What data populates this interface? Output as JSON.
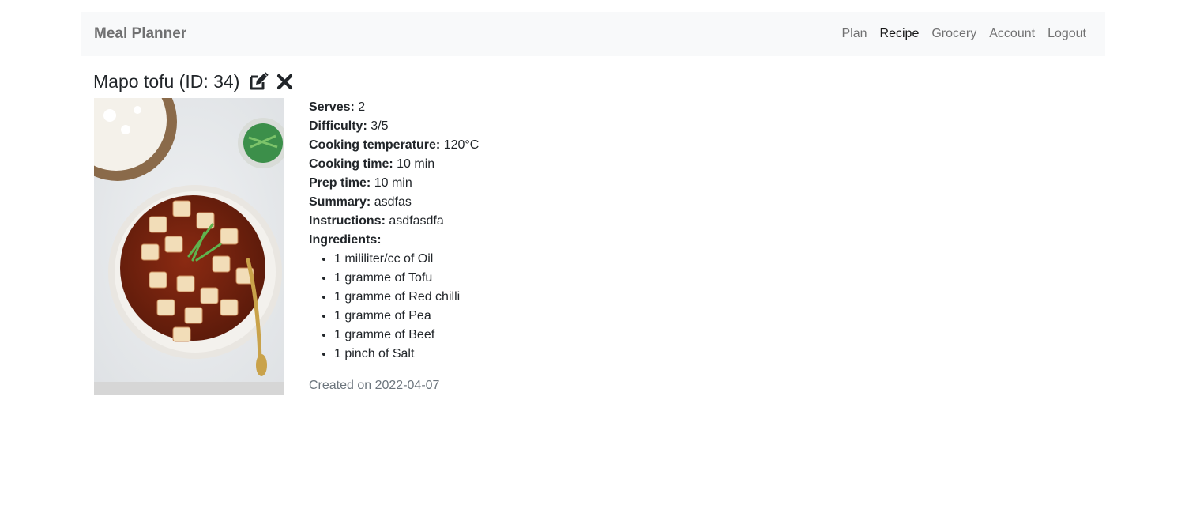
{
  "nav": {
    "brand": "Meal Planner",
    "links": [
      {
        "label": "Plan",
        "active": false
      },
      {
        "label": "Recipe",
        "active": true
      },
      {
        "label": "Grocery",
        "active": false
      },
      {
        "label": "Account",
        "active": false
      },
      {
        "label": "Logout",
        "active": false
      }
    ]
  },
  "recipe": {
    "title": "Mapo tofu (ID: 34)",
    "fields": [
      {
        "label": "Serves:",
        "value": "2"
      },
      {
        "label": "Difficulty:",
        "value": "3/5"
      },
      {
        "label": "Cooking temperature:",
        "value": "120°C"
      },
      {
        "label": "Cooking time:",
        "value": "10 min"
      },
      {
        "label": "Prep time:",
        "value": "10 min"
      },
      {
        "label": "Summary:",
        "value": "asdfas"
      },
      {
        "label": "Instructions:",
        "value": "asdfasdfa"
      }
    ],
    "ingredients_label": "Ingredients:",
    "ingredients": [
      "1 mililiter/cc of Oil",
      "1 gramme of Tofu",
      "1 gramme of Red chilli",
      "1 gramme of Pea",
      "1 gramme of Beef",
      "1 pinch of Salt"
    ],
    "created": "Created on 2022-04-07"
  },
  "icons": {
    "edit": "edit-icon",
    "delete": "close-icon"
  },
  "colors": {
    "navbar_bg": "#f8f9fa",
    "muted_text": "#6c757d"
  }
}
